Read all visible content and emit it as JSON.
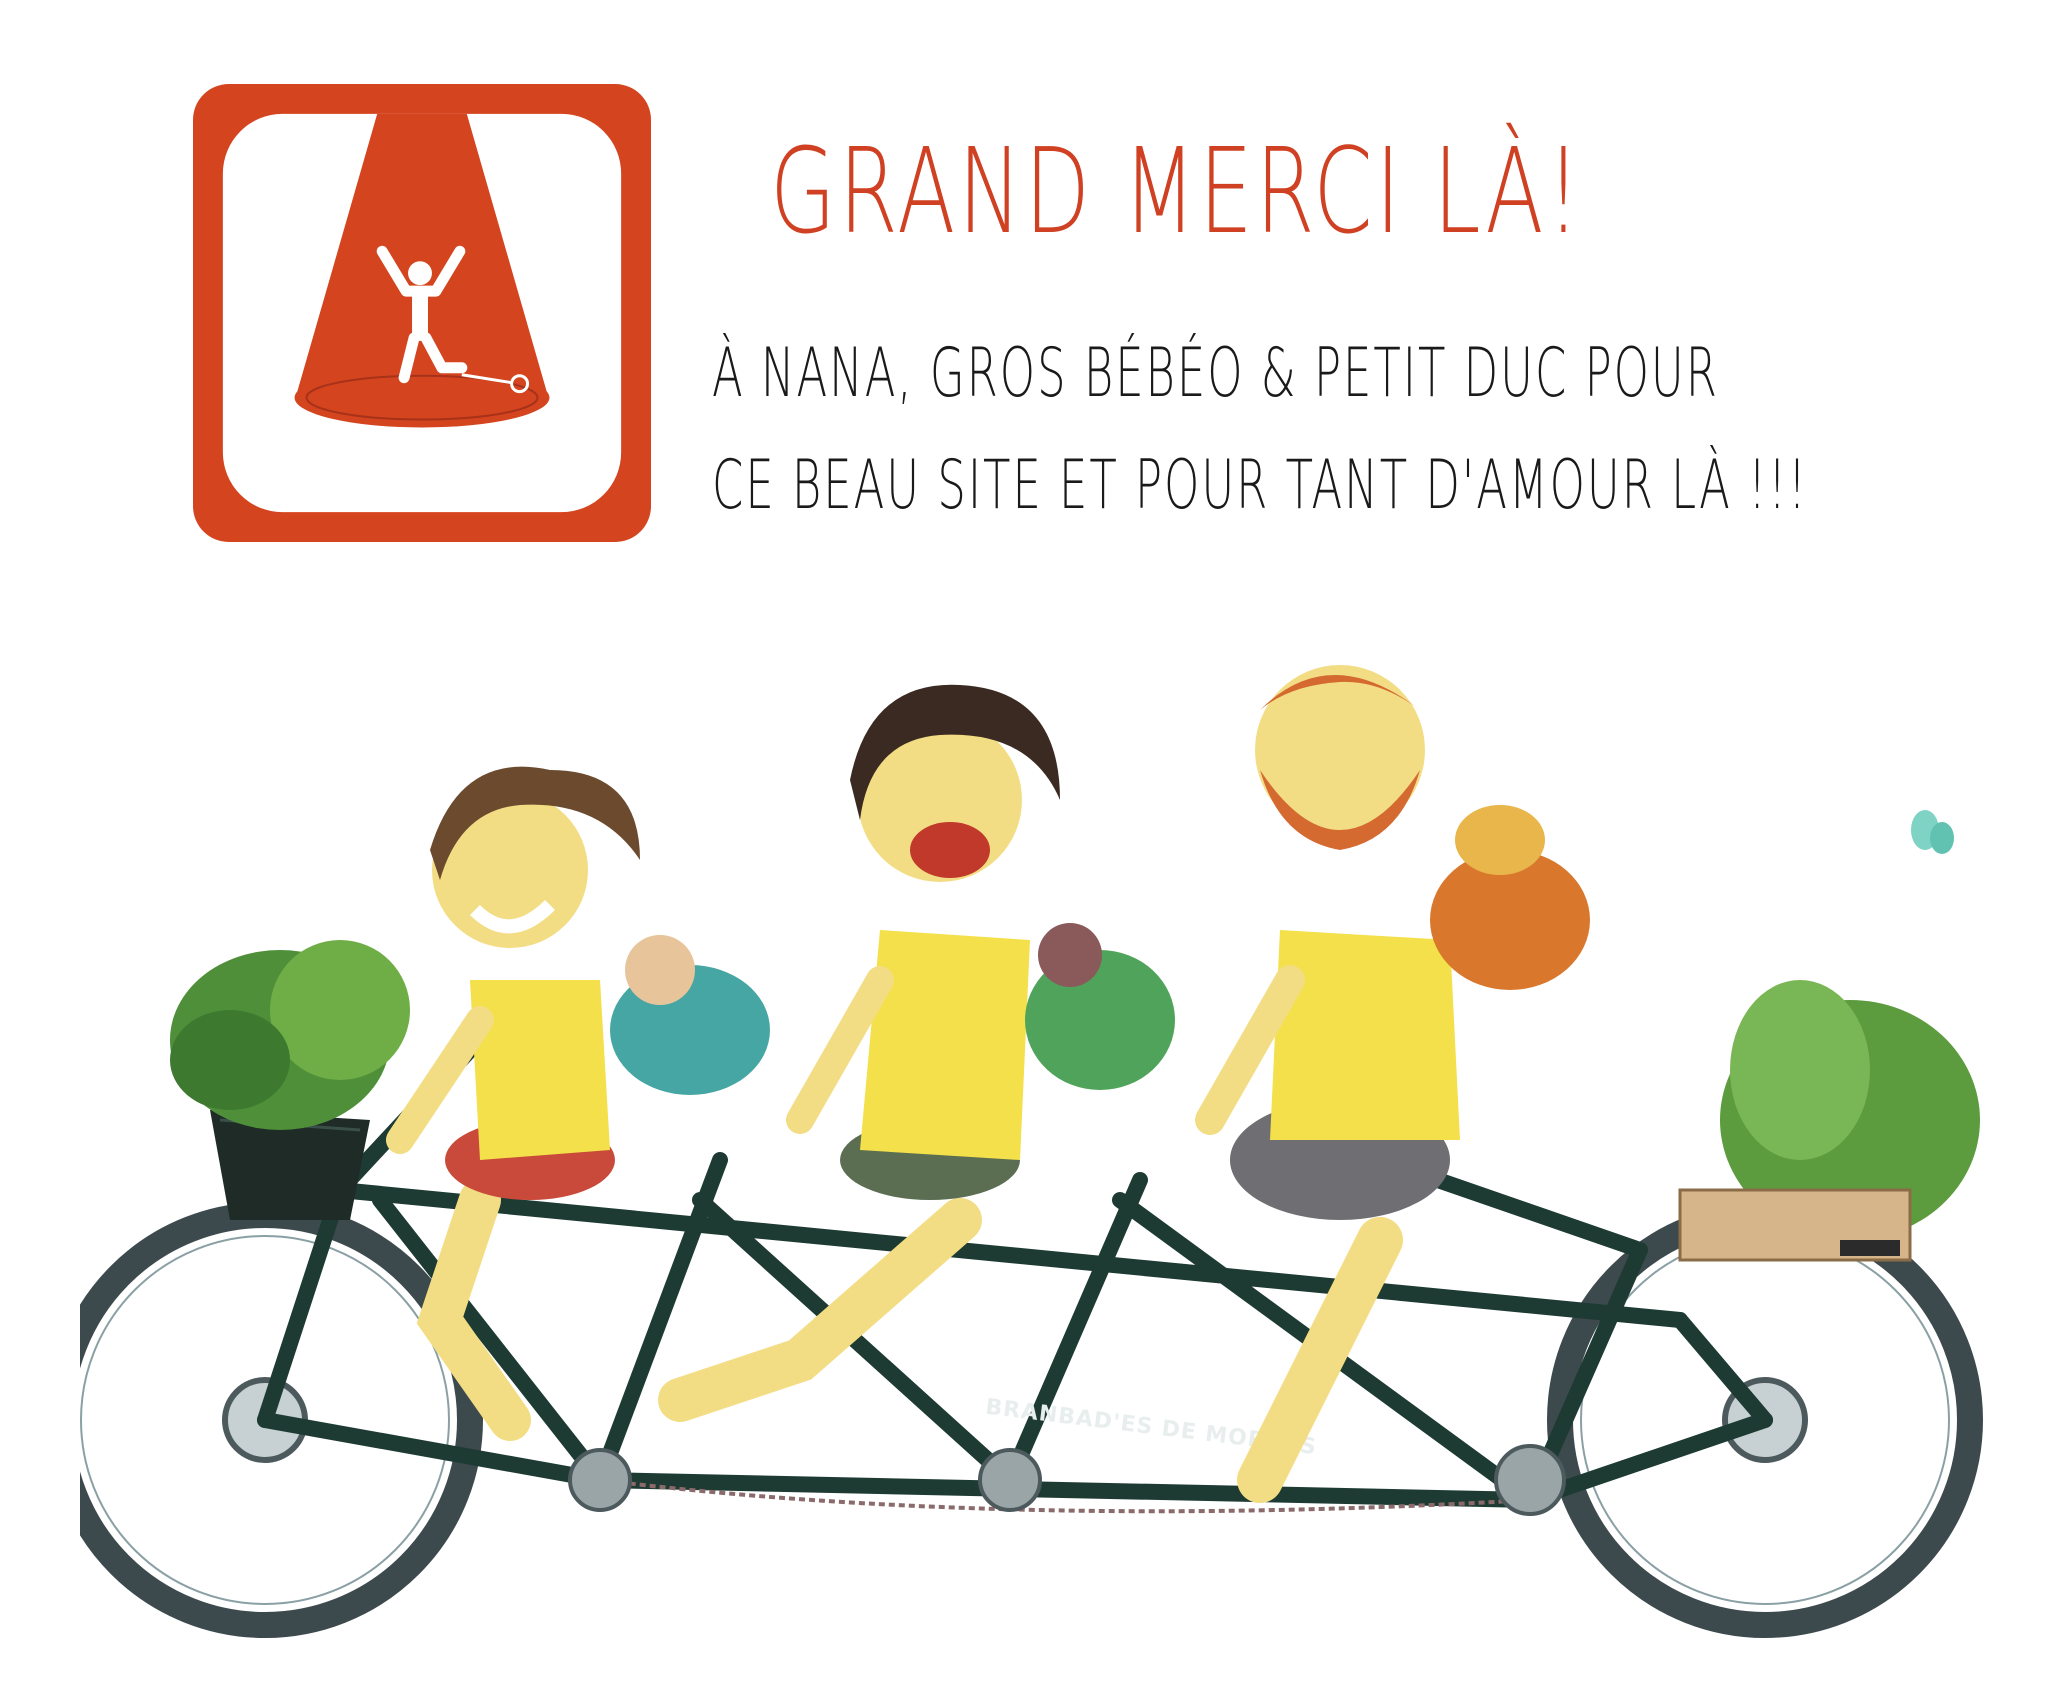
{
  "header": {
    "title": "GRAND MERCI LÀ!",
    "message_line_1": "À NANA, GROS BÉBÉO & PETIT DUC POUR",
    "message_line_2": "CE BEAU SITE ET POUR TANT D'AMOUR LÀ !!!"
  },
  "illustration": {
    "frame_lettering": "BRANBAD'ES DE MORUES"
  },
  "colors": {
    "brand_orange": "#d4451f",
    "title_text": "#cf4122",
    "body_text": "#1a1a1a",
    "shirt_yellow": "#f3e04a",
    "frame_green": "#1e3b33",
    "skin": "#f3dd84"
  }
}
